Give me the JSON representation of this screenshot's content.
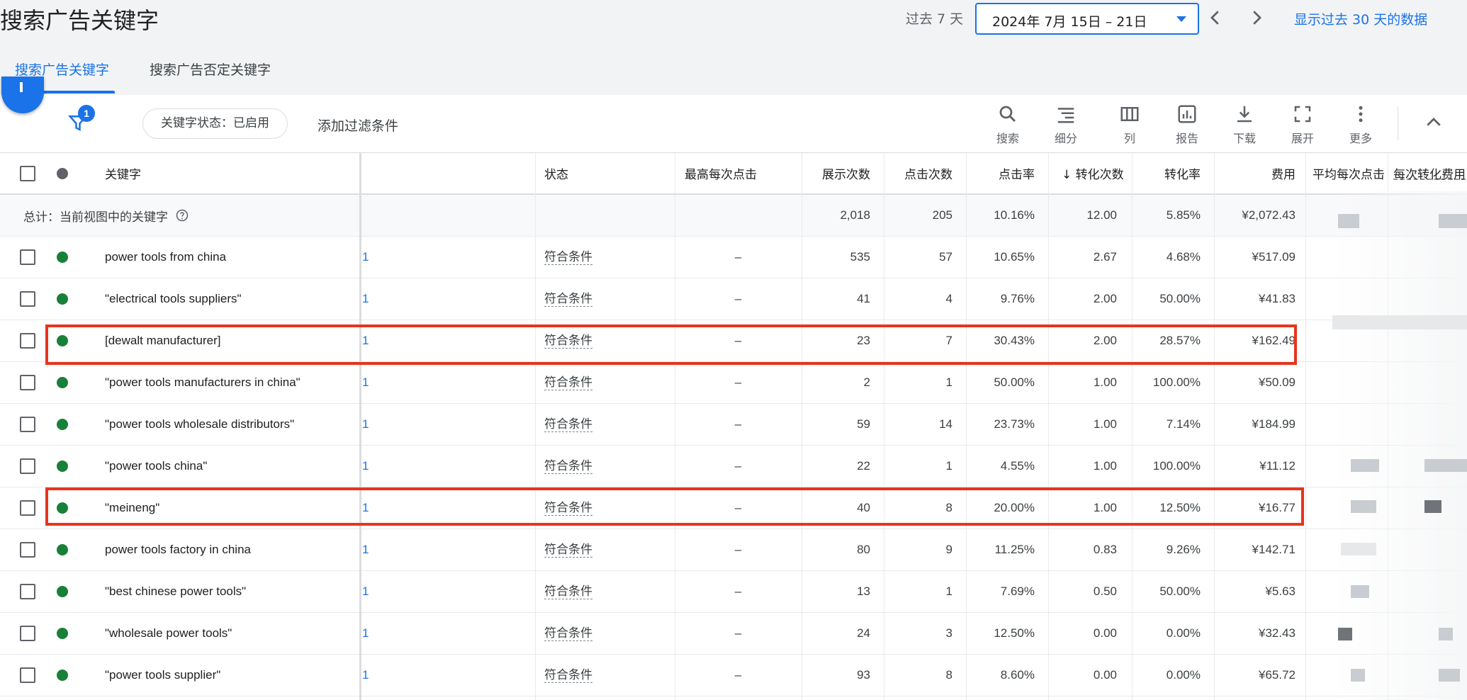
{
  "header": {
    "title": "搜索广告关键字",
    "range_label": "过去 7 天",
    "date_range": "2024年 7月 15日 – 21日",
    "show_30_days": "显示过去 30 天的数据"
  },
  "tabs": [
    {
      "label": "搜索广告关键字",
      "active": true
    },
    {
      "label": "搜索广告否定关键字",
      "active": false
    }
  ],
  "filter_bar": {
    "filter_count": "1",
    "chip_label": "关键字状态：已启用",
    "add_filter": "添加过滤条件"
  },
  "toolbar": [
    {
      "icon": "search-icon",
      "label": "搜索"
    },
    {
      "icon": "segment-icon",
      "label": "细分"
    },
    {
      "icon": "columns-icon",
      "label": "列"
    },
    {
      "icon": "report-icon",
      "label": "报告"
    },
    {
      "icon": "download-icon",
      "label": "下载"
    },
    {
      "icon": "expand-icon",
      "label": "展开"
    },
    {
      "icon": "more-icon",
      "label": "更多"
    }
  ],
  "table": {
    "headers": {
      "keyword": "关键字",
      "status": "状态",
      "max_cpc": "最高每次点击",
      "impressions": "展示次数",
      "clicks": "点击次数",
      "ctr": "点击率",
      "conversions": "↓ 转化次数",
      "conv_rate": "转化率",
      "cost": "费用",
      "avg_cpc": "平均每次点击",
      "cost_per_conv": "每次转化费用"
    },
    "total": {
      "label": "总计：当前视图中的关键字",
      "impressions": "2,018",
      "clicks": "205",
      "ctr": "10.16%",
      "conversions": "12.00",
      "conv_rate": "5.85%",
      "cost": "¥2,072.43"
    },
    "rows": [
      {
        "keyword": "power tools from china",
        "adgroup": "1",
        "status": "符合条件",
        "max_cpc": "–",
        "impressions": "535",
        "clicks": "57",
        "ctr": "10.65%",
        "conversions": "2.67",
        "conv_rate": "4.68%",
        "cost": "¥517.09"
      },
      {
        "keyword": "\"electrical tools suppliers\"",
        "adgroup": "1",
        "status": "符合条件",
        "max_cpc": "–",
        "impressions": "41",
        "clicks": "4",
        "ctr": "9.76%",
        "conversions": "2.00",
        "conv_rate": "50.00%",
        "cost": "¥41.83"
      },
      {
        "keyword": "[dewalt manufacturer]",
        "adgroup": "1",
        "status": "符合条件",
        "max_cpc": "–",
        "impressions": "23",
        "clicks": "7",
        "ctr": "30.43%",
        "conversions": "2.00",
        "conv_rate": "28.57%",
        "cost": "¥162.49"
      },
      {
        "keyword": "\"power tools manufacturers in china\"",
        "adgroup": "1",
        "status": "符合条件",
        "max_cpc": "–",
        "impressions": "2",
        "clicks": "1",
        "ctr": "50.00%",
        "conversions": "1.00",
        "conv_rate": "100.00%",
        "cost": "¥50.09"
      },
      {
        "keyword": "\"power tools wholesale distributors\"",
        "adgroup": "1",
        "status": "符合条件",
        "max_cpc": "–",
        "impressions": "59",
        "clicks": "14",
        "ctr": "23.73%",
        "conversions": "1.00",
        "conv_rate": "7.14%",
        "cost": "¥184.99"
      },
      {
        "keyword": "\"power tools china\"",
        "adgroup": "1",
        "status": "符合条件",
        "max_cpc": "–",
        "impressions": "22",
        "clicks": "1",
        "ctr": "4.55%",
        "conversions": "1.00",
        "conv_rate": "100.00%",
        "cost": "¥11.12"
      },
      {
        "keyword": "\"meineng\"",
        "adgroup": "1",
        "status": "符合条件",
        "max_cpc": "–",
        "impressions": "40",
        "clicks": "8",
        "ctr": "20.00%",
        "conversions": "1.00",
        "conv_rate": "12.50%",
        "cost": "¥16.77"
      },
      {
        "keyword": "power tools factory in china",
        "adgroup": "1",
        "status": "符合条件",
        "max_cpc": "–",
        "impressions": "80",
        "clicks": "9",
        "ctr": "11.25%",
        "conversions": "0.83",
        "conv_rate": "9.26%",
        "cost": "¥142.71"
      },
      {
        "keyword": "\"best chinese power tools\"",
        "adgroup": "1",
        "status": "符合条件",
        "max_cpc": "–",
        "impressions": "13",
        "clicks": "1",
        "ctr": "7.69%",
        "conversions": "0.50",
        "conv_rate": "50.00%",
        "cost": "¥5.63"
      },
      {
        "keyword": "\"wholesale power tools\"",
        "adgroup": "1",
        "status": "符合条件",
        "max_cpc": "–",
        "impressions": "24",
        "clicks": "3",
        "ctr": "12.50%",
        "conversions": "0.00",
        "conv_rate": "0.00%",
        "cost": "¥32.43"
      },
      {
        "keyword": "\"power tools supplier\"",
        "adgroup": "1",
        "status": "符合条件",
        "max_cpc": "–",
        "impressions": "93",
        "clicks": "8",
        "ctr": "8.60%",
        "conversions": "0.00",
        "conv_rate": "0.00%",
        "cost": "¥65.72"
      }
    ]
  },
  "colors": {
    "accent": "#1a73e8",
    "enabled_dot": "#188038",
    "highlight_box": "#e8341c"
  }
}
